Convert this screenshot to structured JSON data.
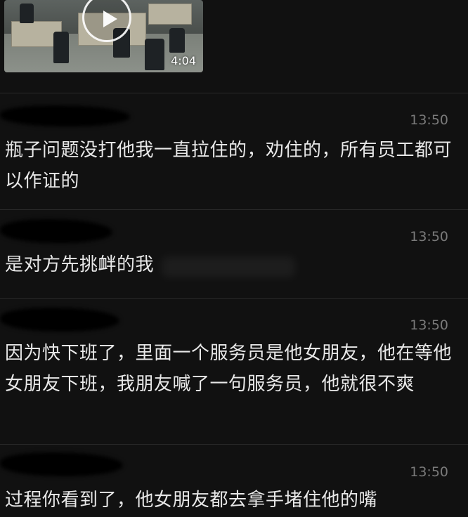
{
  "video": {
    "duration": "4:04",
    "play_icon": "play-icon"
  },
  "messages": [
    {
      "time": "13:50",
      "text": "瓶子问题没打他我一直拉住的，劝住的，所有员工都可以作证的"
    },
    {
      "time": "13:50",
      "text": "是对方先挑衅的我"
    },
    {
      "time": "13:50",
      "text": "因为快下班了，里面一个服务员是他女朋友，他在等他女朋友下班，我朋友喊了一句服务员，他就很不爽"
    },
    {
      "time": "13:50",
      "text": "过程你看到了，他女朋友都去拿手堵住他的嘴"
    }
  ],
  "colors": {
    "background": "#111111",
    "text": "#e8e8e8",
    "timestamp": "#7a7a7a",
    "divider": "#2a2a2a"
  }
}
